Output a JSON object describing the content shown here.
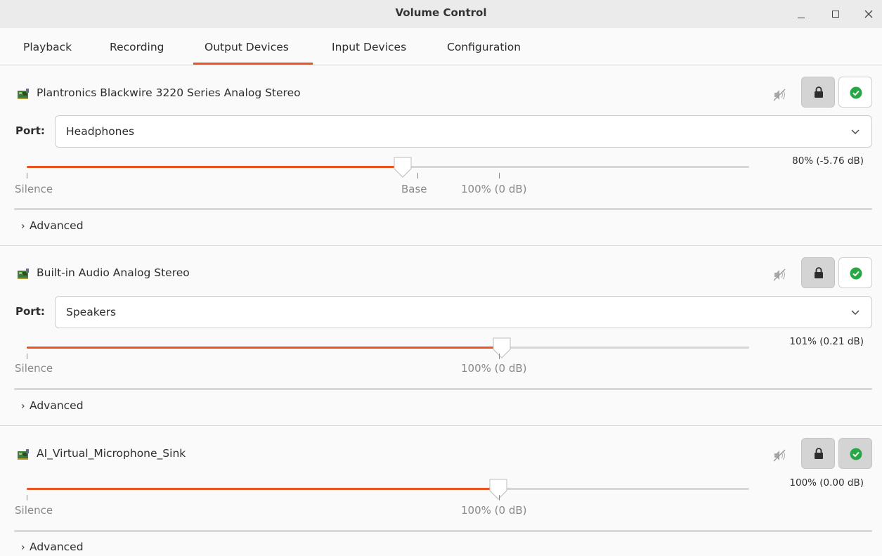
{
  "window": {
    "title": "Volume Control",
    "accent_color": "#e95420"
  },
  "tabs": [
    {
      "label": "Playback"
    },
    {
      "label": "Recording"
    },
    {
      "label": "Output Devices",
      "active": true
    },
    {
      "label": "Input Devices"
    },
    {
      "label": "Configuration"
    }
  ],
  "devices": [
    {
      "name": "Plantronics Blackwire 3220 Series Analog Stereo",
      "port_label": "Port:",
      "port_value": "Headphones",
      "volume_text": "80% (-5.76 dB)",
      "volume_fraction": 0.52,
      "marks": {
        "silence": "Silence",
        "base": "Base",
        "hundred": "100% (0 dB)"
      },
      "advanced_label": "Advanced",
      "is_default": false,
      "icons": {
        "device": "sound-card-icon",
        "mute": "speaker-muted-icon",
        "lock": "lock-icon",
        "default": "check-circle-icon"
      }
    },
    {
      "name": "Built-in Audio Analog Stereo",
      "port_label": "Port:",
      "port_value": "Speakers",
      "volume_text": "101% (0.21 dB)",
      "volume_fraction": 0.658,
      "marks": {
        "silence": "Silence",
        "hundred": "100% (0 dB)"
      },
      "advanced_label": "Advanced",
      "is_default": false,
      "icons": {
        "device": "sound-card-icon",
        "mute": "speaker-muted-icon",
        "lock": "lock-icon",
        "default": "check-circle-icon"
      }
    },
    {
      "name": "AI_Virtual_Microphone_Sink",
      "volume_text": "100% (0.00 dB)",
      "volume_fraction": 0.653,
      "marks": {
        "silence": "Silence",
        "hundred": "100% (0 dB)"
      },
      "advanced_label": "Advanced",
      "is_default": true,
      "icons": {
        "device": "sound-card-icon",
        "mute": "speaker-muted-icon",
        "lock": "lock-icon",
        "default": "check-circle-icon"
      }
    }
  ]
}
